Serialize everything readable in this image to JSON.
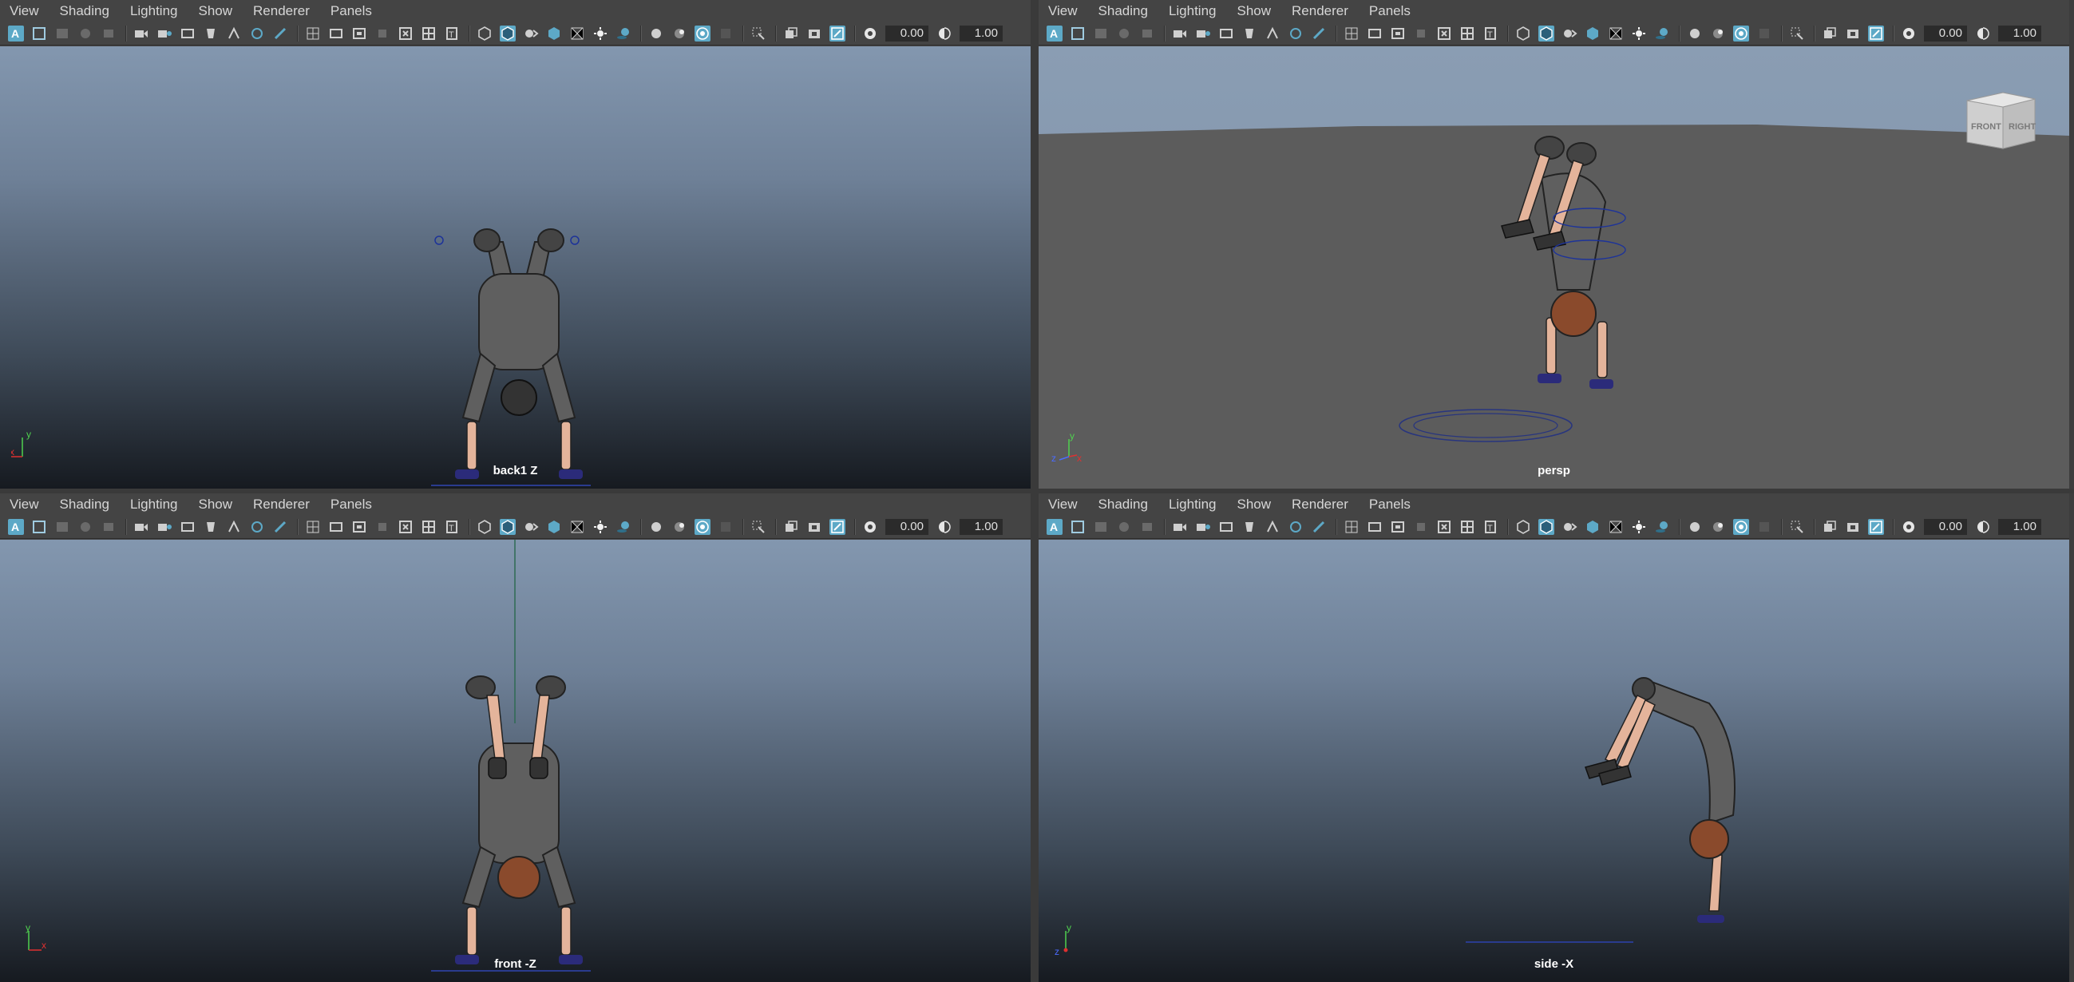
{
  "menu": [
    "View",
    "Shading",
    "Lighting",
    "Show",
    "Renderer",
    "Panels"
  ],
  "toolbar": {
    "exposure_value": "0.00",
    "gamma_value": "1.00"
  },
  "icons": {
    "toolbar": [
      "select-camera-icon",
      "camera-attributes-icon",
      "bookmarks-icon",
      "image-plane-icon",
      "2d-pan-zoom-icon",
      "grease-pencil-icon",
      "grid-icon",
      "film-gate-icon",
      "resolution-gate-icon",
      "gate-mask-icon",
      "field-chart-icon",
      "safe-action-icon",
      "safe-title-icon",
      "wireframe-icon",
      "smooth-shade-icon",
      "default-material-icon",
      "textured-icon",
      "use-all-lights-icon",
      "shadows-icon",
      "screen-space-ambient-occlusion-icon",
      "motion-blur-icon",
      "anti-aliasing-icon",
      "depth-of-field-icon",
      "isolate-select-icon",
      "xray-icon",
      "xray-active-components-icon",
      "xray-joints-icon",
      "exposure-icon",
      "gamma-icon"
    ]
  },
  "colors": {
    "active_icon": "#5da9c7",
    "label": "#ffffff",
    "axis_x": "#e03030",
    "axis_y": "#4fd14f",
    "axis_z": "#4b6bff"
  },
  "viewports": {
    "top_left": {
      "camera": "back1 Z",
      "axes": [
        "y",
        "x"
      ]
    },
    "top_right": {
      "camera": "persp",
      "axes": [
        "y",
        "z",
        "x"
      ],
      "view_cube": {
        "front": "FRONT",
        "right": "RIGHT"
      }
    },
    "bottom_left": {
      "camera": "front -Z",
      "axes": [
        "y",
        "x"
      ]
    },
    "bottom_right": {
      "camera": "side -X",
      "axes": [
        "y",
        "z"
      ]
    }
  }
}
